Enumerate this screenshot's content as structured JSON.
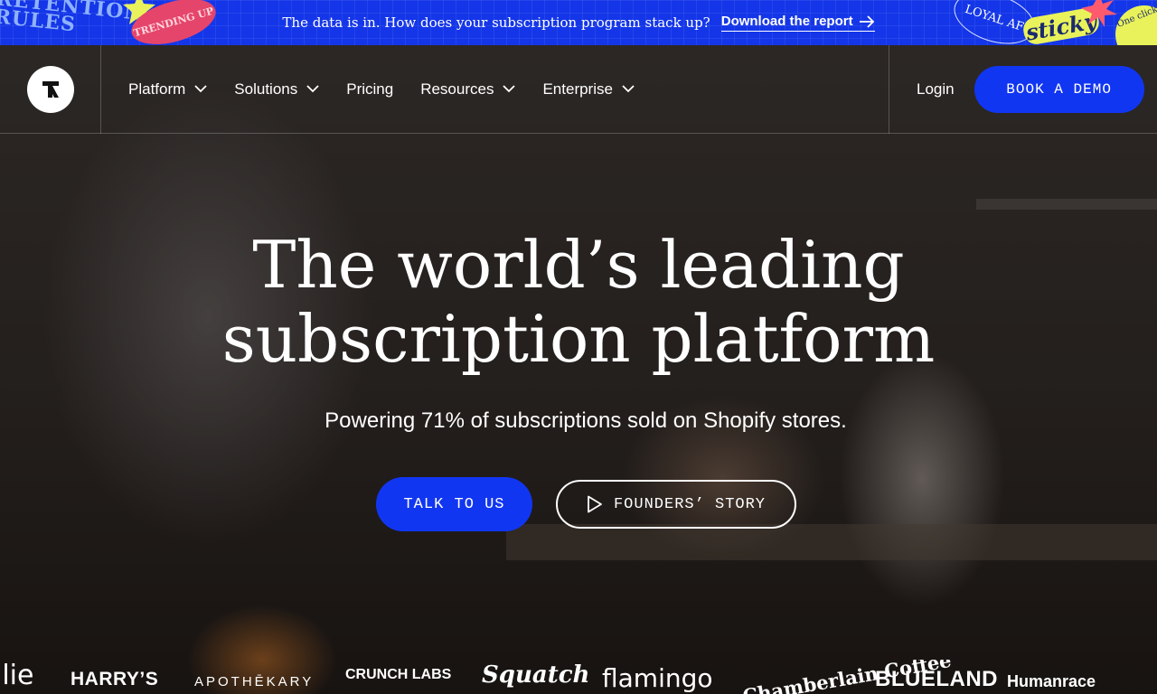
{
  "banner": {
    "message": "The data is in. How does your subscription program stack up?",
    "link_label": "Download the report",
    "stickers": {
      "retention": "RETENTION RULES",
      "trending": "TRENDING UP",
      "loyal": "LOYAL AF",
      "sticky": "sticky",
      "one_click": "One click"
    },
    "colors": {
      "background": "#1436e8",
      "sticker_pink": "#e5456b",
      "sticker_yellow": "#e9f25a"
    }
  },
  "nav": {
    "items": [
      {
        "label": "Platform",
        "has_dropdown": true
      },
      {
        "label": "Solutions",
        "has_dropdown": true
      },
      {
        "label": "Pricing",
        "has_dropdown": false
      },
      {
        "label": "Resources",
        "has_dropdown": true
      },
      {
        "label": "Enterprise",
        "has_dropdown": true
      }
    ],
    "login_label": "Login",
    "demo_label": "BOOK A DEMO"
  },
  "hero": {
    "headline_line1": "The world’s leading",
    "headline_line2": "subscription platform",
    "subheadline": "Powering 71% of subscriptions sold on Shopify stores.",
    "primary_cta": "TALK TO US",
    "secondary_cta": "FOUNDERS’ STORY"
  },
  "brands": [
    "llie",
    "HARRY’S",
    "APOTHĒKARY",
    "CRUNCH LABS",
    "Squatch",
    "flamingo",
    "Chamberlain Coffee",
    "BLUELAND",
    "Humanrace"
  ],
  "accent_color": "#1136f2"
}
